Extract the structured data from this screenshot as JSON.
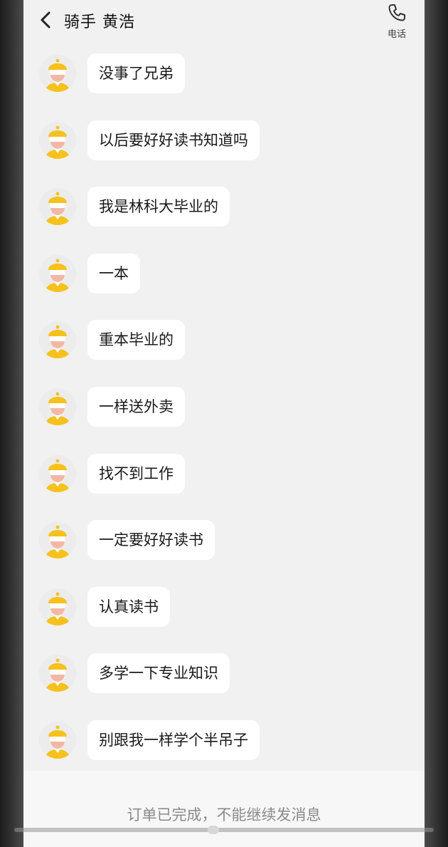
{
  "header": {
    "title": "骑手 黄浩",
    "call_label": "电话"
  },
  "messages": [
    {
      "text": "没事了兄弟"
    },
    {
      "text": "以后要好好读书知道吗"
    },
    {
      "text": "我是林科大毕业的"
    },
    {
      "text": "一本"
    },
    {
      "text": "重本毕业的"
    },
    {
      "text": "一样送外卖"
    },
    {
      "text": "找不到工作"
    },
    {
      "text": "一定要好好读书"
    },
    {
      "text": "认真读书"
    },
    {
      "text": "多学一下专业知识"
    },
    {
      "text": "别跟我一样学个半吊子"
    }
  ],
  "footer": {
    "notice": "订单已完成，不能继续发消息"
  },
  "colors": {
    "background": "#f1f1f1",
    "bubble": "#ffffff",
    "avatar_helmet": "#f7c31c"
  },
  "icons": {
    "back": "chevron-left-icon",
    "call": "phone-icon",
    "avatar": "rider-avatar-icon"
  }
}
